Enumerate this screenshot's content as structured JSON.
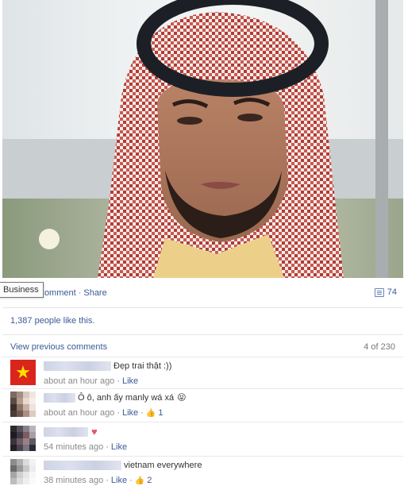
{
  "post": {
    "photo_alt": "",
    "actions": {
      "comment_label": "Comment",
      "share_label": "Share",
      "comment_count": "74"
    },
    "tooltip": "Business",
    "likes_text": "1,387 people like this.",
    "view_previous": "View previous comments",
    "pagination": "4 of 230"
  },
  "comments": [
    {
      "author": "",
      "text": "Đẹp trai thật :))",
      "time": "about an hour ago",
      "like_label": "Like",
      "likes": ""
    },
    {
      "author": "",
      "text": "Ô ô, anh ấy manly wá xá",
      "time": "about an hour ago",
      "like_label": "Like",
      "likes": "1"
    },
    {
      "author": "",
      "text": "",
      "time": "54 minutes ago",
      "like_label": "Like",
      "likes": ""
    },
    {
      "author": "",
      "text": "vietnam everywhere",
      "time": "38 minutes ago",
      "like_label": "Like",
      "likes": "2"
    }
  ],
  "colors": {
    "link": "#3b5998",
    "meta": "#8a8a8a",
    "flag_red": "#da251d",
    "flag_star": "#ffde00"
  }
}
